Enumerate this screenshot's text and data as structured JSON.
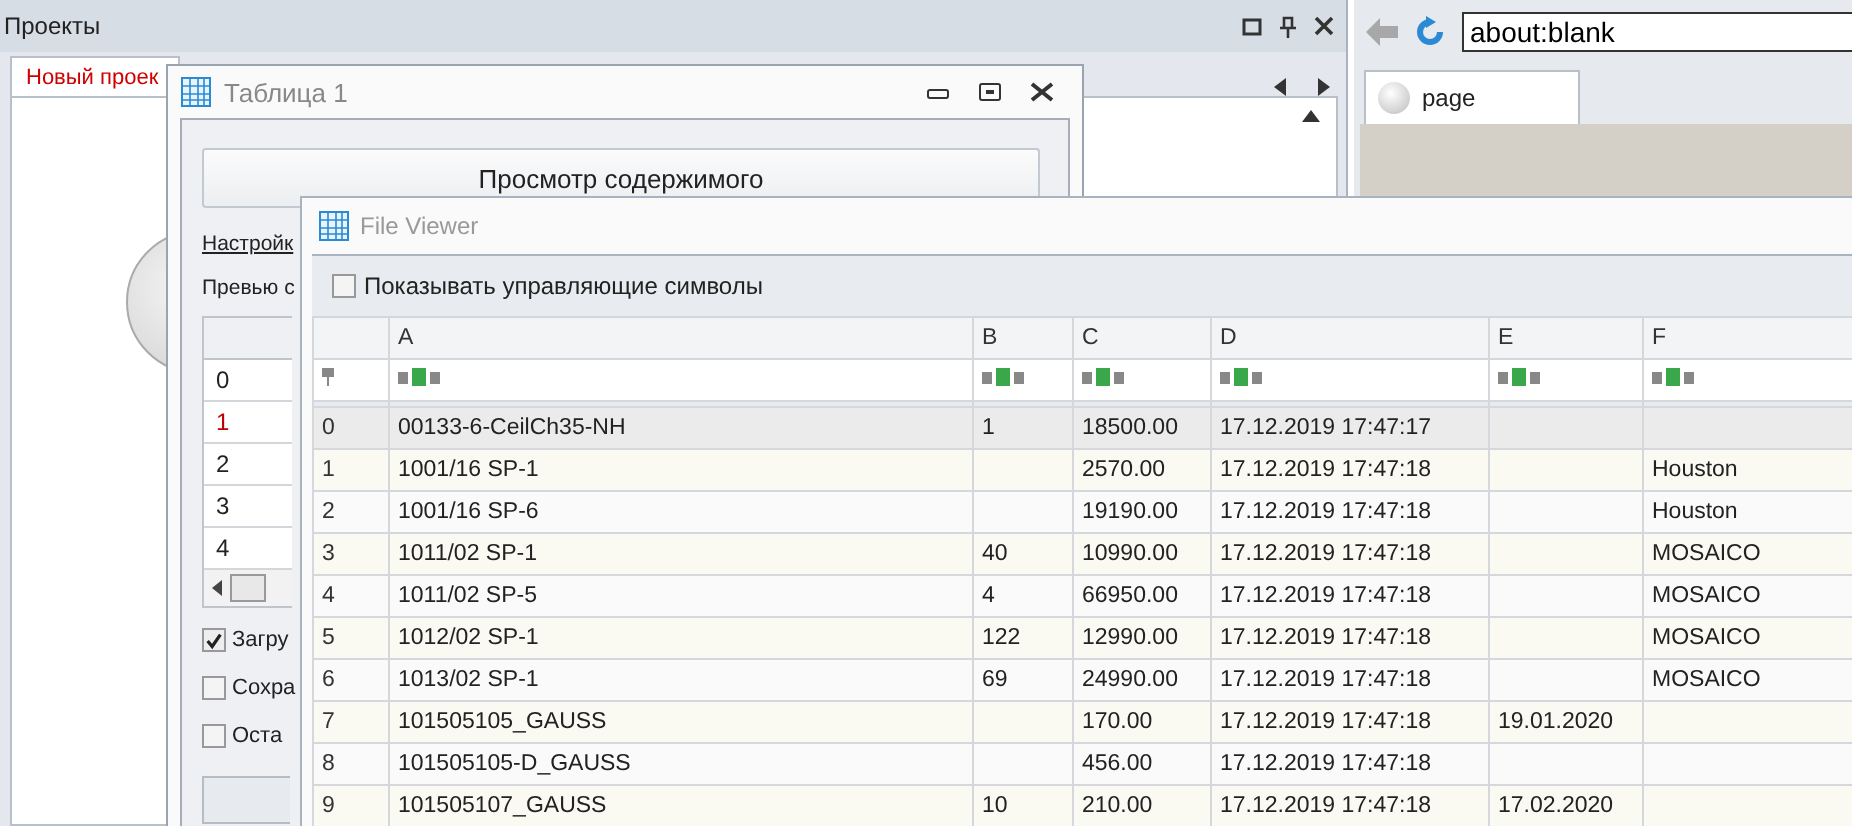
{
  "projects_panel": {
    "title": "Проекты",
    "tabs": [
      {
        "label": "Новый проек",
        "selected": true
      }
    ]
  },
  "browser": {
    "address": "about:blank",
    "tabs": [
      {
        "label": "page",
        "selected": true
      }
    ]
  },
  "table_window": {
    "title": "Таблица 1",
    "view_button": "Просмотр содержимого",
    "settings_link": "Настройк",
    "preview_label": "Превью с",
    "preview_rows": [
      {
        "label": "0",
        "selected": false
      },
      {
        "label": "1",
        "selected": true
      },
      {
        "label": "2",
        "selected": false
      },
      {
        "label": "3",
        "selected": false
      },
      {
        "label": "4",
        "selected": false
      }
    ],
    "checkboxes": [
      {
        "label": "Загру",
        "checked": true
      },
      {
        "label": "Сохра",
        "checked": false
      },
      {
        "label": "Оста",
        "checked": false
      }
    ]
  },
  "file_viewer": {
    "title": "File Viewer",
    "show_control_chars": {
      "label": "Показывать управляющие символы",
      "checked": false
    },
    "columns": [
      "A",
      "B",
      "C",
      "D",
      "E",
      "F"
    ],
    "rows": [
      {
        "index": "0",
        "selected": true,
        "cells": [
          "00133-6-CeilCh35-NH",
          "1",
          "18500.00",
          "17.12.2019 17:47:17",
          "",
          ""
        ]
      },
      {
        "index": "1",
        "selected": false,
        "cells": [
          "1001/16 SP-1",
          "",
          "2570.00",
          "17.12.2019 17:47:18",
          "",
          "Houston"
        ]
      },
      {
        "index": "2",
        "selected": false,
        "cells": [
          "1001/16 SP-6",
          "",
          "19190.00",
          "17.12.2019 17:47:18",
          "",
          "Houston"
        ]
      },
      {
        "index": "3",
        "selected": false,
        "cells": [
          "1011/02 SP-1",
          "40",
          "10990.00",
          "17.12.2019 17:47:18",
          "",
          "MOSAICO"
        ]
      },
      {
        "index": "4",
        "selected": false,
        "cells": [
          "1011/02 SP-5",
          "4",
          "66950.00",
          "17.12.2019 17:47:18",
          "",
          "MOSAICO"
        ]
      },
      {
        "index": "5",
        "selected": false,
        "cells": [
          "1012/02 SP-1",
          "122",
          "12990.00",
          "17.12.2019 17:47:18",
          "",
          "MOSAICO"
        ]
      },
      {
        "index": "6",
        "selected": false,
        "cells": [
          "1013/02 SP-1",
          "69",
          "24990.00",
          "17.12.2019 17:47:18",
          "",
          "MOSAICO"
        ]
      },
      {
        "index": "7",
        "selected": false,
        "cells": [
          "101505105_GAUSS",
          "",
          "170.00",
          "17.12.2019 17:47:18",
          "19.01.2020",
          ""
        ]
      },
      {
        "index": "8",
        "selected": false,
        "cells": [
          "101505105-D_GAUSS",
          "",
          "456.00",
          "17.12.2019 17:47:18",
          "",
          ""
        ]
      },
      {
        "index": "9",
        "selected": false,
        "cells": [
          "101505107_GAUSS",
          "10",
          "210.00",
          "17.12.2019 17:47:18",
          "17.02.2020",
          ""
        ]
      }
    ]
  }
}
